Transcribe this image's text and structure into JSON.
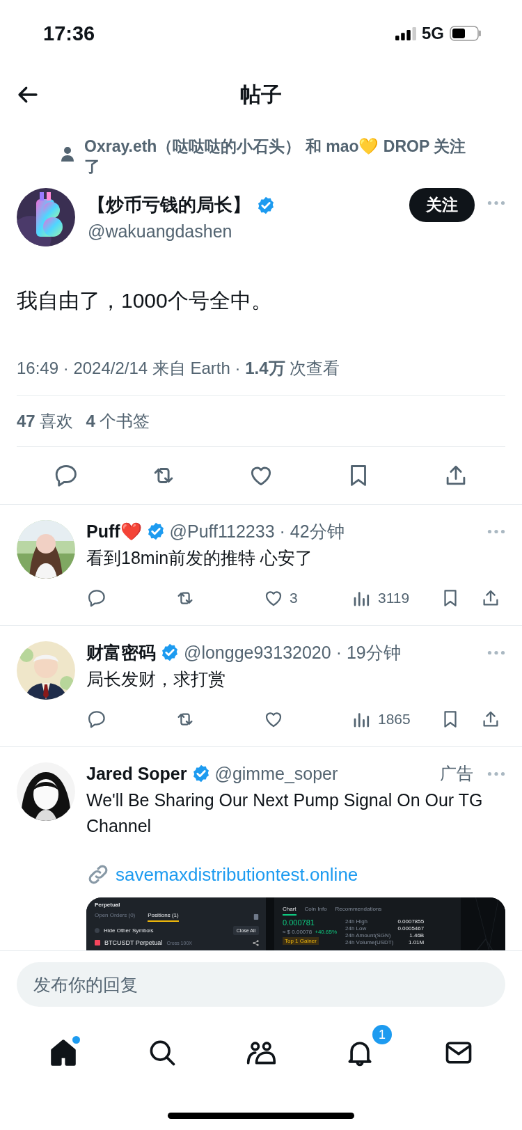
{
  "status_bar": {
    "time": "17:36",
    "network": "5G"
  },
  "header": {
    "title": "帖子"
  },
  "post": {
    "social_context": "Oxray.eth（哒哒哒的小石头） 和 mao💛 DROP 关注了",
    "author": {
      "name": "【炒币亏钱的局长】",
      "verified": true,
      "handle": "@wakuangdashen"
    },
    "follow_label": "关注",
    "text": "我自由了，1000个号全中。",
    "meta": "16:49 · 2024/2/14 来自 Earth · **1.4万** 次查看",
    "stats": [
      "**47** 喜欢",
      "**4** 个书签"
    ]
  },
  "replies": [
    {
      "name": "Puff❤️",
      "verified": true,
      "handle_time": "@Puff112233 · 42分钟",
      "text": "看到18min前发的推特 心安了",
      "likes": "3",
      "views": "3119"
    },
    {
      "name": "财富密码",
      "verified": true,
      "handle_time": "@longge93132020 · 19分钟",
      "text": "局长发财，求打赏",
      "views": "1865"
    }
  ],
  "ad": {
    "name": "Jared Soper",
    "verified": true,
    "handle": "@gimme_soper",
    "label": "广告",
    "text": "We'll Be Sharing Our Next Pump Signal On Our TG Channel",
    "link": "savemaxdistributiontest.online",
    "screenshot": {
      "subtitle": "Perpetual",
      "order_tabs": [
        {
          "label": "Open Orders (0)",
          "selected": false
        },
        {
          "label": "Positions (1)",
          "selected": true
        }
      ],
      "hide_other": false,
      "hide_label": "Hide Other Symbols",
      "close_all": "Close All",
      "position": {
        "symbol": "BTCUSDT Perpetual",
        "margin": "Cross 100X"
      },
      "chart_tabs": [
        {
          "label": "Chart",
          "selected": true
        },
        {
          "label": "Coin Info",
          "selected": false
        },
        {
          "label": "Recommendations",
          "selected": false
        }
      ],
      "price": "0.000781",
      "fiat": "≈ $ 0.00078",
      "change": "+40.65%",
      "gainer": "Top 1 Gainer",
      "stats": [
        {
          "label": "24h High",
          "value": "0.0007855"
        },
        {
          "label": "24h Low",
          "value": "0.0005467"
        },
        {
          "label": "24h Amount(SGN)",
          "value": "1.46B"
        },
        {
          "label": "24h Volume(USDT)",
          "value": "1.01M"
        }
      ]
    }
  },
  "composer": {
    "placeholder": "发布你的回复"
  },
  "nav": [
    {
      "kind": "home",
      "selected": true,
      "dot": true
    },
    {
      "kind": "search",
      "selected": false,
      "dot": false
    },
    {
      "kind": "communities",
      "selected": false,
      "dot": false
    },
    {
      "kind": "notifications",
      "selected": false,
      "dot": false,
      "badge": "1"
    },
    {
      "kind": "messages",
      "selected": false,
      "dot": false
    }
  ]
}
